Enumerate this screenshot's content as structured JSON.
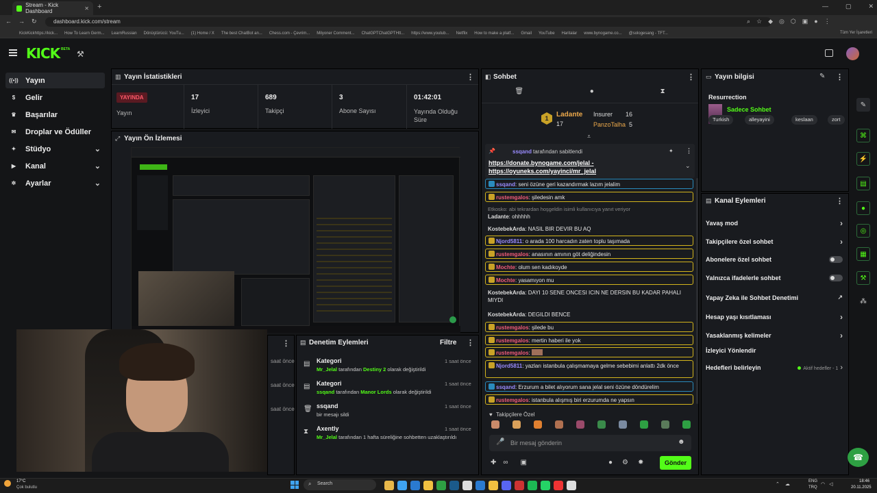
{
  "browser": {
    "tab_title": "Stream - Kick Dashboard",
    "url": "dashboard.kick.com/stream",
    "bookmarks": [
      "KickKickhttps://kick...",
      "How To Learn Germ...",
      "LearnRussian",
      "Dönüştürücü: YouTu...",
      "(1) Home / X",
      "The best ChatBot an...",
      "Chess.com - Çevrim...",
      "Milyoner Comment...",
      "ChatGPTChatGPTHtt...",
      "https://www.youtub...",
      "Netflix",
      "How to make a platf...",
      "Gmail",
      "YouTube",
      "Haritalar",
      "www.bynogame.co...",
      "@sologesang - TFT..."
    ],
    "all_bookmarks": "Tüm Yer İşaretleri"
  },
  "header": {
    "logo": "KICK",
    "beta": "BETA"
  },
  "sidebar": {
    "items": [
      {
        "label": "Yayın",
        "icon": "broadcast-icon"
      },
      {
        "label": "Gelir",
        "icon": "money-icon"
      },
      {
        "label": "Başarılar",
        "icon": "trophy-icon"
      },
      {
        "label": "Droplar ve Ödüller",
        "icon": "gift-icon"
      },
      {
        "label": "Stüdyo",
        "icon": "studio-icon"
      },
      {
        "label": "Kanal",
        "icon": "channel-icon"
      },
      {
        "label": "Ayarlar",
        "icon": "gear-icon"
      }
    ]
  },
  "stats": {
    "title": "Yayın İstatistikleri",
    "live_badge": "YAYINDA",
    "live_label": "Yayın",
    "viewers": "17",
    "viewers_label": "İzleyici",
    "followers": "689",
    "followers_label": "Takipçi",
    "subs": "3",
    "subs_label": "Abone Sayısı",
    "uptime": "01:42:01",
    "uptime_label": "Yayında Olduğu Süre"
  },
  "preview": {
    "title": "Yayın Ön İzlemesi"
  },
  "audit": {
    "title": "Denetim Eylemleri",
    "filter": "Filtre",
    "left_times": [
      "saat önce",
      "saat önce",
      "saat önce"
    ],
    "items": [
      {
        "title": "Kategori",
        "user": "Mr_Jelal",
        "mid": " tarafından ",
        "target": "Destiny 2",
        "tail": " olarak değiştirildi",
        "time": "1 saat önce"
      },
      {
        "title": "Kategori",
        "user": "ssqand",
        "mid": " tarafından ",
        "target": "Manor Lords",
        "tail": " olarak değiştirildi",
        "time": "1 saat önce"
      },
      {
        "title": "ssqand",
        "user": "",
        "mid": "bir mesajı sildi",
        "target": "",
        "tail": "",
        "time": "1 saat önce"
      },
      {
        "title": "Axently",
        "user": "Mr_Jelal",
        "mid": " tarafından 1 hafta süreliğine sohbetten uzaklaştırıldı",
        "target": "",
        "tail": "",
        "time": "1 saat önce"
      }
    ]
  },
  "chat": {
    "title": "Sohbet",
    "leaderboard": {
      "first_name": "Ladante",
      "first_count": "17",
      "second_name": "Insurer",
      "second_count": "16",
      "third_name": "PanzoTalha",
      "third_count": "5"
    },
    "pinned_by": "ssqand",
    "pinned_suffix": "tarafından sabitlendi",
    "pinned_link1": "https://donate.bynogame.com/jelal -",
    "pinned_link2": "https://oyuneks.com/yayinci/mr_jelal",
    "messages": [
      {
        "user": "ssqand",
        "text": "seni özüne geri kazandırmak lazım jelalim",
        "style": "b",
        "uc": "ub"
      },
      {
        "user": "rustemgalos",
        "text": "şiledesin amk",
        "style": "y",
        "uc": "ur"
      },
      {
        "reply": "Etkosko: abi tekrardan hoşgeldin isimli kullanıcıya yanıt veriyor",
        "user": "Ladante",
        "text": "ohhhhh",
        "style": "",
        "uc": "uw"
      },
      {
        "user": "KostebekArda",
        "text": "NASIL BIR DEVIR BU AQ",
        "style": "",
        "uc": "uw"
      },
      {
        "user": "Njord5811",
        "text": "o arada 100 harcadın zaten toplu taşımada",
        "style": "y",
        "uc": "ub"
      },
      {
        "user": "rustemgalos",
        "text": "anasının amının göt deliğindesin",
        "style": "y",
        "uc": "ur"
      },
      {
        "user": "Mochte",
        "text": "olum sen kadıkoyde",
        "style": "y",
        "uc": "ur"
      },
      {
        "user": "Mochte",
        "text": "yasamıyon mu",
        "style": "y",
        "uc": "ur"
      },
      {
        "user": "KostebekArda",
        "text": "DAYI 10 SENE ONCESI ICIN NE DERSIN BU KADAR PAHALI MIYDI",
        "style": "",
        "uc": "uw"
      },
      {
        "user": "KostebekArda",
        "text": "DEGILDI BENCE",
        "style": "",
        "uc": "uw"
      },
      {
        "user": "rustemgalos",
        "text": "şilede bu",
        "style": "y",
        "uc": "ur"
      },
      {
        "user": "rustemgalos",
        "text": "mertin haberi ile yok",
        "style": "y",
        "uc": "ur"
      },
      {
        "user": "rustemgalos",
        "text": "",
        "style": "y",
        "uc": "ur"
      },
      {
        "user": "Njord5811",
        "text": "yazları istanbula çalışmamaya gelme sebebimi anlattı 2dk önce",
        "style": "y",
        "uc": "ub"
      },
      {
        "user": "ssqand",
        "text": "Erzurum a bilet alıyorum sana jelal seni özüne döndürelim",
        "style": "b",
        "uc": "ub"
      },
      {
        "user": "rustemgalos",
        "text": "istanbula alışmış biri erzurumda ne yapsın",
        "style": "y",
        "uc": "ur"
      }
    ],
    "emote_section": "Takipçilere Özel",
    "input_placeholder": "Bir mesaj gönderin",
    "send": "Gönder"
  },
  "stream_info": {
    "title": "Yayın bilgisi",
    "stream_title": "Resurrection",
    "category": "Sadece Sohbet",
    "tags": [
      "Turkish",
      "alleyayini",
      "keslaan",
      "zort"
    ]
  },
  "channel_actions": {
    "title": "Kanal Eylemleri",
    "items": [
      {
        "label": "Yavaş mod",
        "kind": "arrow"
      },
      {
        "label": "Takipçilere özel sohbet",
        "kind": "arrow"
      },
      {
        "label": "Abonelere özel sohbet",
        "kind": "toggle"
      },
      {
        "label": "Yalnızca ifadelerle sohbet",
        "kind": "toggle"
      },
      {
        "label": "Yapay Zeka ile Sohbet Denetimi",
        "kind": "ext"
      },
      {
        "label": "Hesap yaşı kısıtlaması",
        "kind": "arrow"
      },
      {
        "label": "Yasaklanmış kelimeler",
        "kind": "arrow"
      },
      {
        "label": "İzleyici Yönlendir",
        "kind": "none"
      },
      {
        "label": "Hedefleri belirleyin",
        "kind": "goal"
      }
    ],
    "goal_status": "Aktif hedefler - 1"
  },
  "taskbar": {
    "weather_temp": "17°C",
    "weather_desc": "Çok bulutlu",
    "search": "Search",
    "lang1": "ENG",
    "lang2": "TRQ",
    "time": "18:46",
    "date": "20.11.2025"
  },
  "colors": {
    "accent": "#53fc18",
    "live": "#e5344b",
    "highlight_yellow": "#d4b51c",
    "highlight_blue": "#2a8bbd"
  }
}
